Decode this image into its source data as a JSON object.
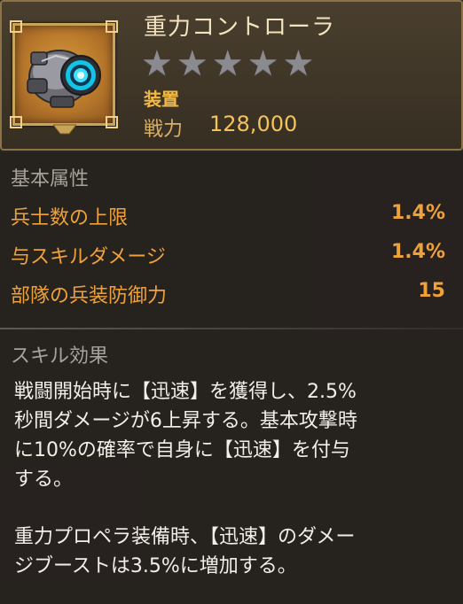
{
  "item": {
    "name": "重力コントローラ",
    "star_count": 5,
    "stars_filled": 0,
    "type_label": "装置",
    "power_label": "戦力",
    "power_value": "128,000",
    "icon": "gravity-controller-device-icon"
  },
  "basic_attributes": {
    "section_title": "基本属性",
    "rows": [
      {
        "name": "兵士数の上限",
        "value": "1.4%"
      },
      {
        "name": "与スキルダメージ",
        "value": "1.4%"
      },
      {
        "name": "部隊の兵装防御力",
        "value": "15"
      }
    ]
  },
  "skill": {
    "section_title": "スキル効果",
    "lines_1": [
      "戦闘開始時に【迅速】を獲得し、2.5%",
      "秒間ダメージが6上昇する。基本攻撃時",
      "に10%の確率で自身に【迅速】を付与",
      "する。"
    ],
    "lines_2": [
      "重力プロペラ装備時、【迅速】のダメー",
      "ジブーストは3.5%に増加する。"
    ]
  },
  "colors": {
    "accent": "#f0a23a",
    "title": "#f3e3c0",
    "frame_gold": "#c8a45a",
    "star_gray": "#8a8a90"
  }
}
